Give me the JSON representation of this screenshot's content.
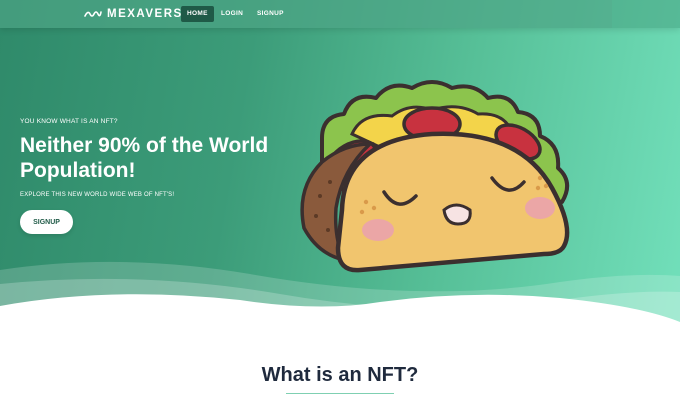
{
  "nav": {
    "brand": "MEXAVERSE",
    "brand_icon": "infinity-chain-icon",
    "items": [
      {
        "label": "HOME",
        "active": true
      },
      {
        "label": "LOGIN",
        "active": false
      },
      {
        "label": "SIGNUP",
        "active": false
      }
    ]
  },
  "hero": {
    "eyebrow": "YOU KNOW WHAT IS AN NFT?",
    "headline": "Neither 90% of the World Population!",
    "subline": "EXPLORE THIS NEW WORLD WIDE WEB OF NFT'S!",
    "cta_label": "SIGNUP",
    "illustration": "taco-character"
  },
  "section": {
    "title": "What is an NFT?"
  },
  "colors": {
    "accent_dark": "#1f5a47",
    "gradient_start": "#2f8a6a",
    "gradient_end": "#72e0bb",
    "title_text": "#1f2a3d"
  }
}
